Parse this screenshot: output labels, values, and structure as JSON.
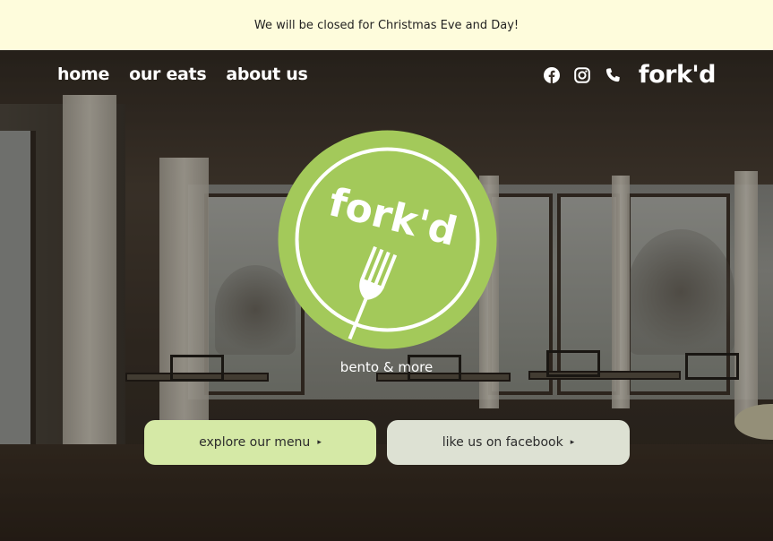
{
  "announcement": "We will be closed for Christmas Eve and Day!",
  "nav": {
    "items": [
      {
        "label": "home"
      },
      {
        "label": "our eats"
      },
      {
        "label": "about us"
      }
    ]
  },
  "header_right": {
    "icons": [
      "facebook-icon",
      "instagram-icon",
      "phone-icon"
    ],
    "brand": "fork'd"
  },
  "logo": {
    "text": "fork'd",
    "color": "#a3c95a"
  },
  "hero": {
    "tagline": "bento & more",
    "buttons": [
      {
        "label": "explore our menu",
        "arrow": "▸"
      },
      {
        "label": "like us on facebook",
        "arrow": "▸"
      }
    ]
  },
  "colors": {
    "banner": "#fefcdc",
    "accent_green": "#a3c95a",
    "button_menu": "#d5e9a6",
    "button_facebook": "#dde1d3"
  }
}
